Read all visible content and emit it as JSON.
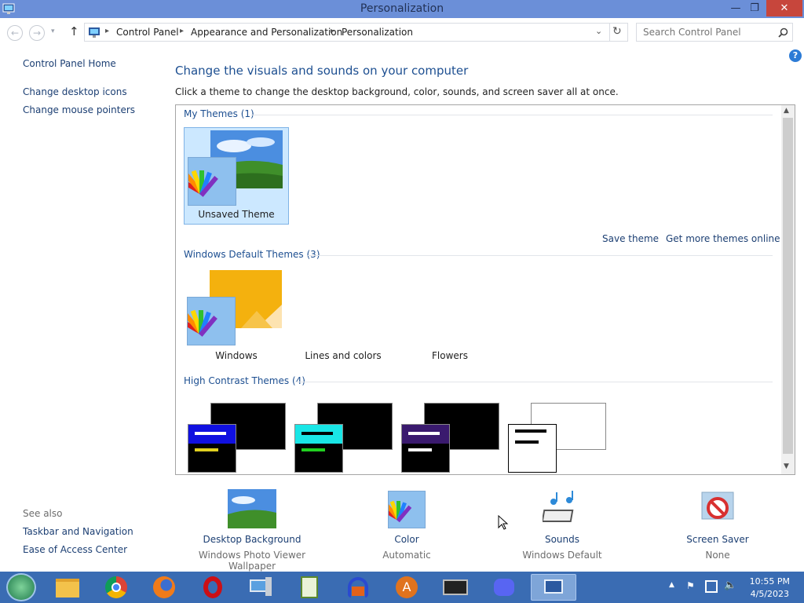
{
  "window": {
    "title": "Personalization"
  },
  "nav": {
    "breadcrumb": [
      "Control Panel",
      "Appearance and Personalization",
      "Personalization"
    ],
    "search_placeholder": "Search Control Panel"
  },
  "leftnav": {
    "home": "Control Panel Home",
    "items": [
      "Change desktop icons",
      "Change mouse pointers"
    ],
    "see_also_title": "See also",
    "see_also": [
      "Taskbar and Navigation",
      "Ease of Access Center"
    ]
  },
  "main": {
    "heading": "Change the visuals and sounds on your computer",
    "subheading": "Click a theme to change the desktop background, color, sounds, and screen saver all at once.",
    "my_themes": {
      "title": "My Themes (1)",
      "themes": [
        "Unsaved Theme"
      ]
    },
    "save_theme": "Save theme",
    "get_more": "Get more themes online",
    "default_themes": {
      "title": "Windows Default Themes (3)",
      "themes": [
        "Windows",
        "Lines and colors",
        "Flowers"
      ]
    },
    "high_contrast": {
      "title": "High Contrast Themes (4)"
    }
  },
  "bottom": [
    {
      "label": "Desktop Background",
      "value": "Windows Photo Viewer Wallpaper"
    },
    {
      "label": "Color",
      "value": "Automatic"
    },
    {
      "label": "Sounds",
      "value": "Windows Default"
    },
    {
      "label": "Screen Saver",
      "value": "None"
    }
  ],
  "taskbar": {
    "apps": [
      "start-orb",
      "file-explorer",
      "chrome",
      "firefox",
      "opera",
      "this-pc",
      "notepad",
      "headphones",
      "app-a",
      "display",
      "discord",
      "control-panel"
    ],
    "time": "10:55 PM",
    "date": "4/5/2023"
  },
  "colors": {
    "accent": "#1d4f91",
    "titlebar": "#6b8fd8",
    "taskbar": "#3a6cb3",
    "close": "#c7463c"
  }
}
